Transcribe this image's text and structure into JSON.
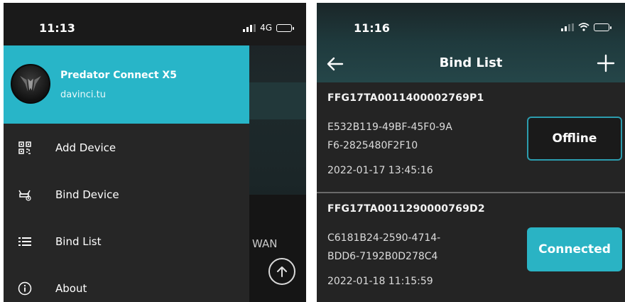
{
  "left_screen": {
    "status": {
      "time": "11:13",
      "network": "4G"
    },
    "drawer": {
      "app_name": "Predator Connect X5",
      "user": "davinci.tu",
      "items": [
        {
          "label": "Add Device",
          "icon": "qr-scan-icon"
        },
        {
          "label": "Bind Device",
          "icon": "router-link-icon"
        },
        {
          "label": "Bind List",
          "icon": "list-icon"
        },
        {
          "label": "About",
          "icon": "info-icon"
        }
      ]
    },
    "background": {
      "wan_label": "WAN"
    }
  },
  "right_screen": {
    "status": {
      "time": "11:16"
    },
    "nav": {
      "title": "Bind List",
      "back_icon": "arrow-left-icon",
      "add_icon": "plus-icon"
    },
    "devices": [
      {
        "serial": "FFG17TA0011400002769P1",
        "uuid": "E532B119-49BF-45F0-9AF6-2825480F2F10",
        "uuid_line1": "E532B119-49BF-45F0-9A",
        "uuid_line2": "F6-2825480F2F10",
        "date": "2022-01-17 13:45:16",
        "status": "Offline"
      },
      {
        "serial": "FFG17TA0011290000769D2",
        "uuid": "C6181B24-2590-4714-BDD6-7192B0D278C4",
        "uuid_line1": "C6181B24-2590-4714-",
        "uuid_line2": "BDD6-7192B0D278C4",
        "date": "2022-01-18 11:15:59",
        "status": "Connected"
      }
    ]
  },
  "colors": {
    "accent": "#28b5c8",
    "drawer_bg": "#262626",
    "list_bg": "#242424"
  }
}
